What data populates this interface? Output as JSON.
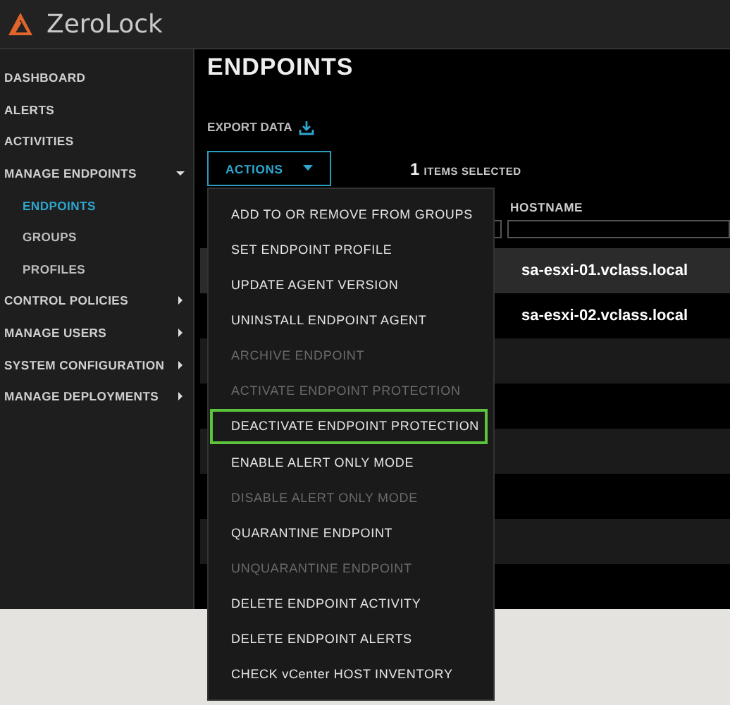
{
  "header": {
    "app_name": "ZeroLock"
  },
  "sidebar": {
    "items": [
      {
        "label": "DASHBOARD"
      },
      {
        "label": "ALERTS"
      },
      {
        "label": "ACTIVITIES"
      },
      {
        "label": "MANAGE ENDPOINTS",
        "expanded": true,
        "children": [
          {
            "label": "ENDPOINTS",
            "selected": true
          },
          {
            "label": "GROUPS",
            "selected": false
          },
          {
            "label": "PROFILES",
            "selected": false
          }
        ]
      },
      {
        "label": "CONTROL POLICIES",
        "expanded": false
      },
      {
        "label": "MANAGE USERS",
        "expanded": false
      },
      {
        "label": "SYSTEM CONFIGURATION",
        "expanded": false
      },
      {
        "label": "MANAGE DEPLOYMENTS",
        "expanded": false
      }
    ]
  },
  "page": {
    "title": "ENDPOINTS",
    "export_label": "EXPORT DATA",
    "actions_label": "ACTIONS",
    "selected_count": "1",
    "selected_label": "ITEMS SELECTED"
  },
  "table": {
    "columns": [
      "HOSTNAME"
    ],
    "rows": [
      {
        "hostname": "sa-esxi-01.vclass.local",
        "selected": true
      },
      {
        "hostname": "sa-esxi-02.vclass.local",
        "selected": false
      }
    ]
  },
  "actions_menu": {
    "items": [
      {
        "label": "ADD TO OR REMOVE FROM GROUPS",
        "disabled": false,
        "highlighted": false
      },
      {
        "label": "SET ENDPOINT PROFILE",
        "disabled": false,
        "highlighted": false
      },
      {
        "label": "UPDATE AGENT VERSION",
        "disabled": false,
        "highlighted": false
      },
      {
        "label": "UNINSTALL ENDPOINT AGENT",
        "disabled": false,
        "highlighted": false
      },
      {
        "label": "ARCHIVE ENDPOINT",
        "disabled": true,
        "highlighted": false
      },
      {
        "label": "ACTIVATE ENDPOINT PROTECTION",
        "disabled": true,
        "highlighted": false
      },
      {
        "label": "DEACTIVATE ENDPOINT PROTECTION",
        "disabled": false,
        "highlighted": true
      },
      {
        "label": "ENABLE ALERT ONLY MODE",
        "disabled": false,
        "highlighted": false
      },
      {
        "label": "DISABLE ALERT ONLY MODE",
        "disabled": true,
        "highlighted": false
      },
      {
        "label": "QUARANTINE ENDPOINT",
        "disabled": false,
        "highlighted": false
      },
      {
        "label": "UNQUARANTINE ENDPOINT",
        "disabled": true,
        "highlighted": false
      },
      {
        "label": "DELETE ENDPOINT ACTIVITY",
        "disabled": false,
        "highlighted": false
      },
      {
        "label": "DELETE ENDPOINT ALERTS",
        "disabled": false,
        "highlighted": false
      },
      {
        "label": "CHECK vCenter HOST INVENTORY",
        "disabled": false,
        "highlighted": false
      }
    ]
  }
}
